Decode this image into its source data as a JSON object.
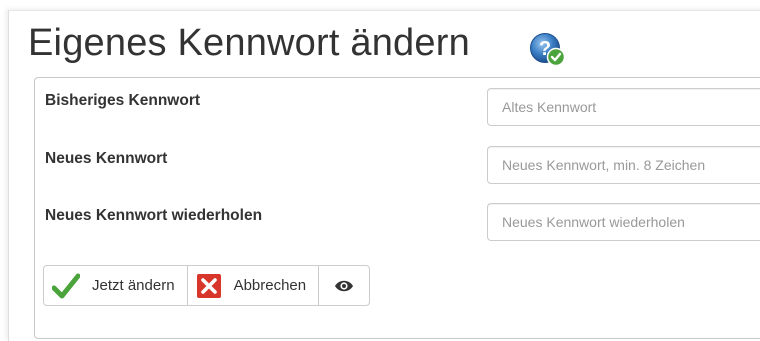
{
  "page": {
    "title": "Eigenes Kennwort ändern",
    "help_icon": "help-question-check-icon"
  },
  "form": {
    "fields": [
      {
        "label": "Bisheriges Kennwort",
        "placeholder": "Altes Kennwort",
        "value": ""
      },
      {
        "label": "Neues Kennwort",
        "placeholder": "Neues Kennwort, min. 8 Zeichen",
        "value": ""
      },
      {
        "label": "Neues Kennwort wiederholen",
        "placeholder": "Neues Kennwort wiederholen",
        "value": ""
      }
    ]
  },
  "actions": {
    "submit_label": "Jetzt ändern",
    "submit_icon": "checkmark-icon",
    "cancel_label": "Abbrechen",
    "cancel_icon": "x-icon",
    "toggle_icon": "eye-icon"
  },
  "colors": {
    "check_green": "#4ba33c",
    "cancel_red": "#d9362b",
    "help_blue": "#2e6fb5"
  }
}
